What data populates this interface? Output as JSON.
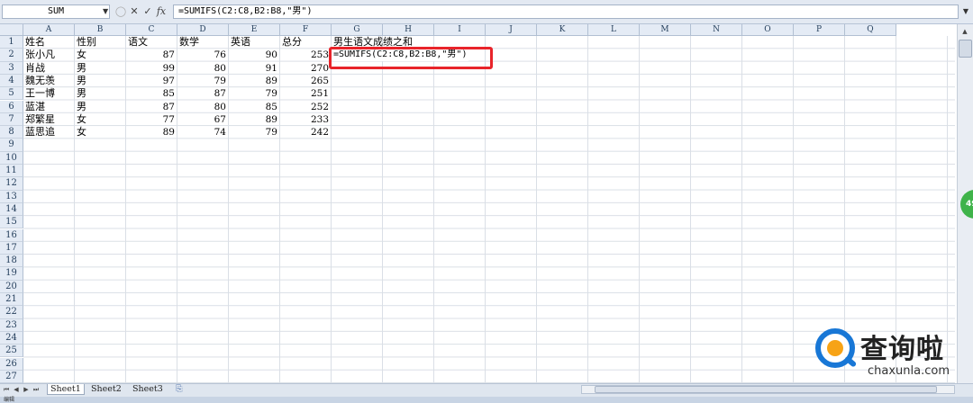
{
  "formula_bar": {
    "name_box": "SUM",
    "cancel_icon": "✕",
    "enter_icon": "✓",
    "fx_label": "fx",
    "formula": "=SUMIFS(C2:C8,B2:B8,\"男\")"
  },
  "columns": [
    "A",
    "B",
    "C",
    "D",
    "E",
    "F",
    "G",
    "H",
    "I",
    "J",
    "K",
    "L",
    "M",
    "N",
    "O",
    "P",
    "Q"
  ],
  "rows": [
    "1",
    "2",
    "3",
    "4",
    "5",
    "6",
    "7",
    "8",
    "9",
    "10",
    "11",
    "12",
    "13",
    "14",
    "15",
    "16",
    "17",
    "18",
    "19",
    "20",
    "21",
    "22",
    "23",
    "24",
    "25",
    "26",
    "27"
  ],
  "sheet": {
    "headers": [
      "姓名",
      "性别",
      "语文",
      "数学",
      "英语",
      "总分"
    ],
    "g1": "男生语文成绩之和",
    "g2_editing": "=SUMIFS(C2:C8,B2:B8,\"男\")",
    "data": [
      [
        "张小凡",
        "女",
        "87",
        "76",
        "90",
        "253"
      ],
      [
        "肖战",
        "男",
        "99",
        "80",
        "91",
        "270"
      ],
      [
        "魏无羡",
        "男",
        "97",
        "79",
        "89",
        "265"
      ],
      [
        "王一博",
        "男",
        "85",
        "87",
        "79",
        "251"
      ],
      [
        "蓝湛",
        "男",
        "87",
        "80",
        "85",
        "252"
      ],
      [
        "郑繁星",
        "女",
        "77",
        "67",
        "89",
        "233"
      ],
      [
        "蓝思追",
        "女",
        "89",
        "74",
        "79",
        "242"
      ]
    ]
  },
  "tabs": {
    "sheet1": "Sheet1",
    "sheet2": "Sheet2",
    "sheet3": "Sheet3"
  },
  "status": {
    "mode": "编辑"
  },
  "side_badge": "49",
  "watermark": {
    "title": "查询啦",
    "url": "chaxunla.com"
  },
  "colors": {
    "highlight": "#e8242a",
    "header_bg": "#e4ebf5",
    "watermark_blue": "#1877d6",
    "watermark_orange": "#f7a316"
  }
}
